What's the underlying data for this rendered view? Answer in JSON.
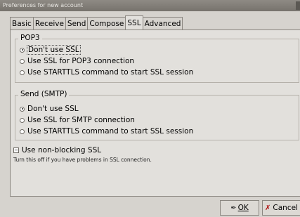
{
  "window": {
    "title": "Preferences for new account"
  },
  "tabs": [
    "Basic",
    "Receive",
    "Send",
    "Compose",
    "SSL",
    "Advanced"
  ],
  "pop3": {
    "label": "POP3",
    "options": [
      "Don't use SSL",
      "Use SSL for POP3 connection",
      "Use STARTTLS command to start SSL session"
    ]
  },
  "smtp": {
    "label": "Send (SMTP)",
    "options": [
      "Don't use SSL",
      "Use SSL for SMTP connection",
      "Use STARTTLS command to start SSL session"
    ]
  },
  "nonblocking": {
    "label": "Use non-blocking SSL",
    "hint": "Turn this off if you have problems in SSL connection."
  },
  "buttons": {
    "ok": "OK",
    "cancel": "Cancel"
  }
}
